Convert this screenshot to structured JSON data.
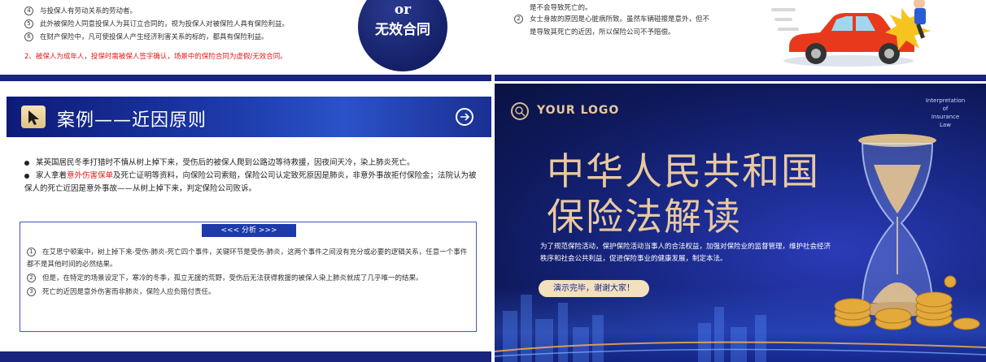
{
  "top_left": {
    "items": [
      {
        "num": "4",
        "text": "与投保人有劳动关系的劳动者。"
      },
      {
        "num": "5",
        "text": "此外被保险人同意投保人为其订立合同的，视为投保人对被保险人具有保险利益。"
      },
      {
        "num": "6",
        "text": "在财产保险中，凡可使投保人产生经济利害关系的标的，都具有保险利益。"
      }
    ],
    "note": "2、被保人为成年人，投保时需被保人签字确认，场景中的保险合同为虚假/无效合同。",
    "badge_or": "or",
    "badge_invalid": "无效合同"
  },
  "top_right": {
    "line1": "是不会导致死亡的。",
    "item_num": "2",
    "line2": "女士身故的原因是心脏病所致。虽然车辆碰擦是意外，但不",
    "line3": "是导致其死亡的近因，所以保险公司不予赔偿。"
  },
  "bottom_left": {
    "title": "案例——近因原则",
    "intro": [
      {
        "text": "某英国居民冬季打猎时不慎从树上掉下来，受伤后的被保人爬到公路边等待救援，因夜间天冷，染上肺炎死亡。"
      },
      {
        "pre": "家人拿着",
        "red": "意外伤害保单",
        "post": "及死亡证明等资料，向保险公司索赔，保险公司认定致死原因是肺炎，非意外事故拒付保险金；法院认为被保人的死亡近因是意外事故——从树上掉下来，判定保险公司败诉。"
      }
    ],
    "analysis_label": "<<<  分析  >>>",
    "analysis": [
      {
        "num": "1",
        "text": "在艾思宁顿案中，树上掉下来-受伤-肺炎-死亡四个事件，关键环节是受伤-肺炎，这两个事件之间没有充分或必要的逻辑关系，任意一个事件都不是其他时间的必然结果。"
      },
      {
        "num": "2",
        "text": "但是，在特定的场景设定下，寒冷的冬季，孤立无援的荒野，受伤后无法获得救援的被保人染上肺炎就成了几乎唯一的结果。"
      },
      {
        "num": "3",
        "text": "死亡的近因是意外伤害而非肺炎，保险人应负赔付责任。"
      }
    ]
  },
  "bottom_right": {
    "logo": "YOUR LOGO",
    "corner": [
      "Interpretation",
      "of",
      "Insurance",
      "Law"
    ],
    "title_line1": "中华人民共和国",
    "title_line2": "保险法解读",
    "description": "为了规范保险活动，保护保险活动当事人的合法权益，加强对保险业的监督管理，维护社会经济秩序和社会公共利益，促进保险事业的健康发展，制定本法。",
    "thanks": "演示完毕，谢谢大家！"
  },
  "colors": {
    "navy": "#1a237e",
    "accent_blue": "#1c3aa8",
    "gold": "#e8c9a0",
    "red": "#e21b1b"
  }
}
